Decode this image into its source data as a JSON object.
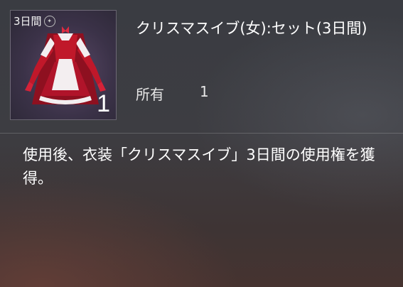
{
  "item": {
    "duration_badge": "3日間",
    "badge_icon": "lock-icon",
    "quantity": "1",
    "name": "クリスマスイブ(女):セット(3日間)",
    "owned_label": "所有",
    "owned_count": "1"
  },
  "description": "使用後、衣装「クリスマスイブ」3日間の使用権を獲得。",
  "colors": {
    "costume_red": "#c0182a",
    "apron_white": "#f3eef0",
    "card_purple": "#3b3248"
  }
}
